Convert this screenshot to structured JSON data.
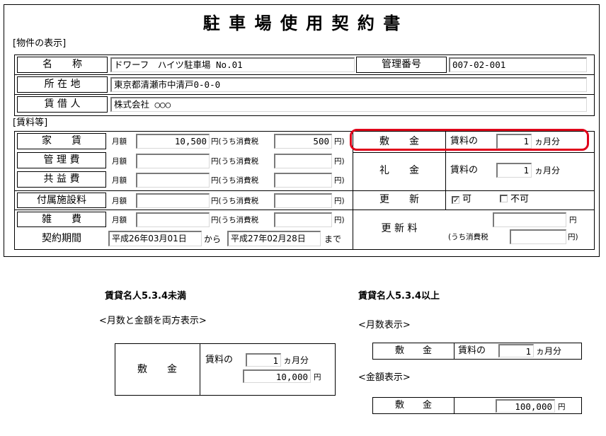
{
  "form": {
    "title": "駐 車 場 使 用 契 約 書",
    "section_property": "[物件の表示]",
    "section_fees": "[賃料等]",
    "property": {
      "name_label": "名　　称",
      "name_value": "ドワーフ　ハイツ駐車場 No.01",
      "mgmt_label": "管理番号",
      "mgmt_value": "007-02-001",
      "address_label": "所 在 地",
      "address_value": "東京都清瀬市中清戸0-0-0",
      "lessee_label": "賃 借 人",
      "lessee_value": "株式会社 ○○○"
    },
    "fees": {
      "monthly": "月額",
      "yen_tax": "円(うち消費税",
      "close": "円)",
      "rows": [
        {
          "label": "家　　賃",
          "amount": "10,500",
          "tax": "500"
        },
        {
          "label": "管 理 費",
          "amount": "",
          "tax": ""
        },
        {
          "label": "共 益 費",
          "amount": "",
          "tax": ""
        },
        {
          "label": "付属施設料",
          "amount": "",
          "tax": ""
        },
        {
          "label": "雑　　費",
          "amount": "",
          "tax": ""
        }
      ],
      "period_label": "契約期間",
      "period_from": "平成26年03月01日",
      "period_kara": "から",
      "period_to": "平成27年02月28日",
      "period_made": "まで"
    },
    "deposit": {
      "shikikin_label": "敷　　金",
      "shikikin_prefix": "賃料の",
      "shikikin_value": "1",
      "shikikin_suffix": "ヵ月分",
      "reikin_label": "礼　　金",
      "reikin_prefix": "賃料の",
      "reikin_value": "1",
      "reikin_suffix": "ヵ月分",
      "renewal_label": "更　　新",
      "renewal_yes": "可",
      "renewal_yes_mark": "✓",
      "renewal_no": "不可",
      "renewal_fee_label": "更 新 料",
      "renewal_fee_yen": "円",
      "renewal_fee_tax_label": "(うち消費税",
      "renewal_fee_close": "円)"
    }
  },
  "examples": {
    "left_title": "賃貸名人5.3.4未満",
    "left_sub": "<月数と金額を両方表示>",
    "left_box": {
      "label": "敷　　金",
      "prefix": "賃料の",
      "months": "1",
      "suffix": "ヵ月分",
      "amount": "10,000",
      "yen": "円"
    },
    "right_title": "賃貸名人5.3.4以上",
    "right_sub1": "<月数表示>",
    "right_box1": {
      "label": "敷　　金",
      "prefix": "賃料の",
      "months": "1",
      "suffix": "ヵ月分"
    },
    "right_sub2": "<金額表示>",
    "right_box2": {
      "label": "敷　　金",
      "amount": "100,000",
      "yen": "円"
    }
  },
  "colors": {
    "highlight": "#e0001a",
    "border": "#000000",
    "field_shadow": "#7a7a7a"
  }
}
